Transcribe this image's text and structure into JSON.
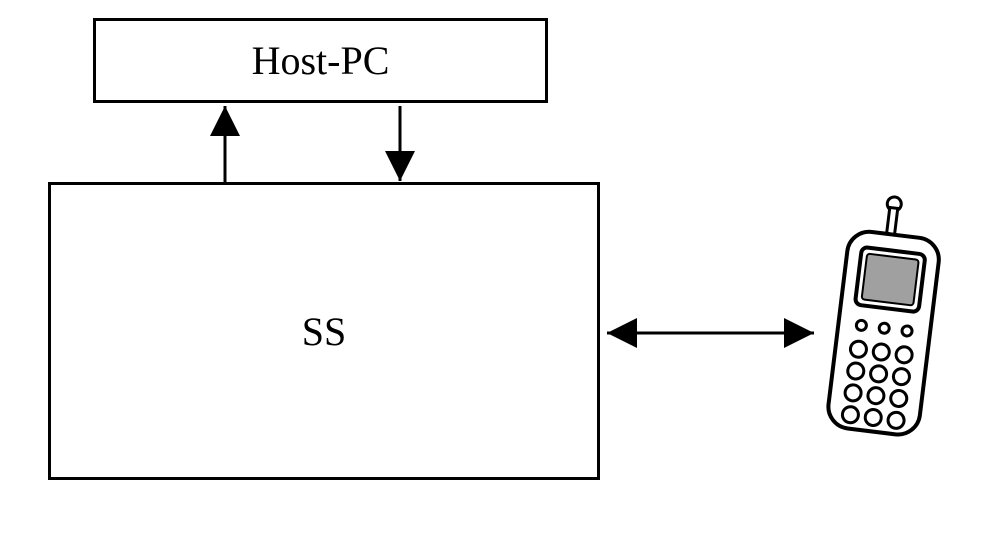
{
  "hostpc": {
    "label": "Host-PC"
  },
  "ss": {
    "label": "SS"
  },
  "device": {
    "name": "mobile-phone"
  }
}
